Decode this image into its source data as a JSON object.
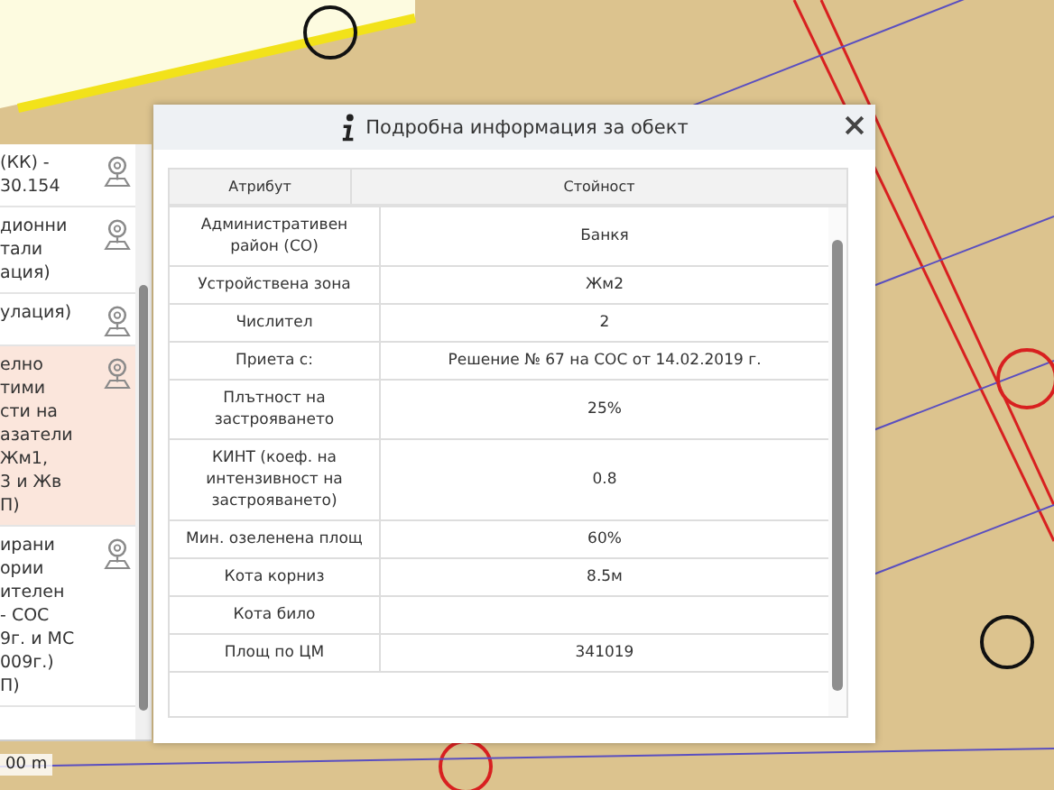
{
  "side_panel": {
    "items": [
      {
        "text": "(КК) -\n30.154",
        "selected": false
      },
      {
        "text": "дионни\nтали\nация)",
        "selected": false
      },
      {
        "text": "улация)",
        "selected": false
      },
      {
        "text": "елно\nтими\nсти на\nазатели\nЖм1,\n3 и Жв\nП)",
        "selected": true
      },
      {
        "text": "ирани\nории\nителен\n- СОС\n9г. и МС\n009г.)\nП)",
        "selected": false
      }
    ]
  },
  "map": {
    "scale_label": "00 m"
  },
  "dialog": {
    "title": "Подробна информация за обект",
    "table": {
      "columns": [
        "Атрибут",
        "Стойност"
      ],
      "rows": [
        [
          "Административен район (СО)",
          "Банкя"
        ],
        [
          "Устройствена зона",
          "Жм2"
        ],
        [
          "Числител",
          "2"
        ],
        [
          "Приета с:",
          "Решение № 67 на СОС от 14.02.2019 г."
        ],
        [
          "Плътност на застрояването",
          "25%"
        ],
        [
          "КИНТ (коеф. на интензивност на застрояването)",
          "0.8"
        ],
        [
          "Мин. озеленена площ",
          "60%"
        ],
        [
          "Кота корниз",
          "8.5м"
        ],
        [
          "Кота било",
          ""
        ],
        [
          "Площ по ЦМ",
          "341019"
        ]
      ]
    }
  }
}
